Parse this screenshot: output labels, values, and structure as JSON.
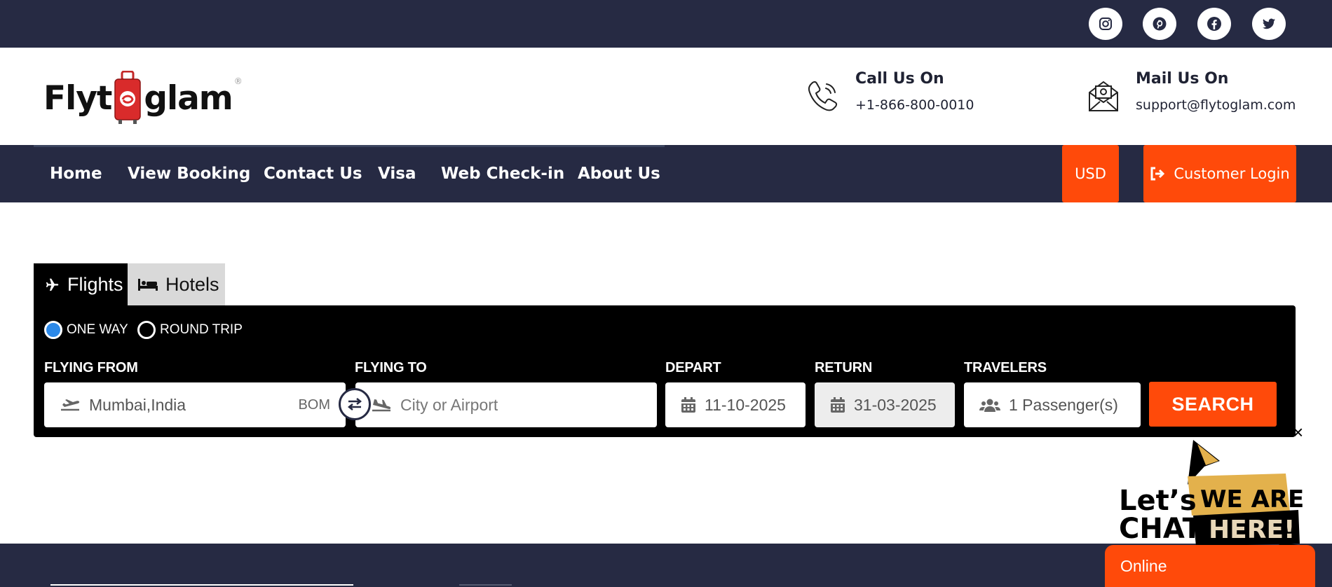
{
  "topbar": {
    "socials": [
      {
        "name": "instagram-icon"
      },
      {
        "name": "pinterest-icon"
      },
      {
        "name": "facebook-icon"
      },
      {
        "name": "twitter-icon"
      }
    ]
  },
  "header": {
    "logo_left": "Flyt",
    "logo_right": "glam",
    "logo_reg": "®",
    "call": {
      "title": "Call Us On",
      "value": "+1-866-800-0010"
    },
    "mail": {
      "title": "Mail Us On",
      "value": "support@flytoglam.com"
    }
  },
  "nav": {
    "items": [
      "Home",
      "View Booking",
      "Contact Us",
      "Visa",
      "Web Check-in",
      "About Us"
    ],
    "currency": "USD",
    "login": "Customer Login"
  },
  "search": {
    "tabs": {
      "flights": "Flights",
      "hotels": "Hotels"
    },
    "trip_types": {
      "one_way": "ONE WAY",
      "round_trip": "ROUND TRIP",
      "selected": "one_way"
    },
    "labels": {
      "from": "FLYING FROM",
      "to": "FLYING TO",
      "depart": "DEPART",
      "return": "RETURN",
      "travelers": "TRAVELERS"
    },
    "from_value": "Mumbai,India",
    "from_code": "BOM",
    "to_placeholder": "City or Airport",
    "depart_value": "11-10-2025",
    "return_value": "31-03-2025",
    "travelers_value": "1 Passenger(s)",
    "button": "SEARCH"
  },
  "chat": {
    "close": "×",
    "line1": "Let’s",
    "line2": "CHAT!",
    "line3": "WE ARE",
    "line4": "HERE!",
    "status": "Online"
  },
  "colors": {
    "navy": "#262a43",
    "accent": "#ff4a0a",
    "radio_selected": "#2c89e8"
  }
}
